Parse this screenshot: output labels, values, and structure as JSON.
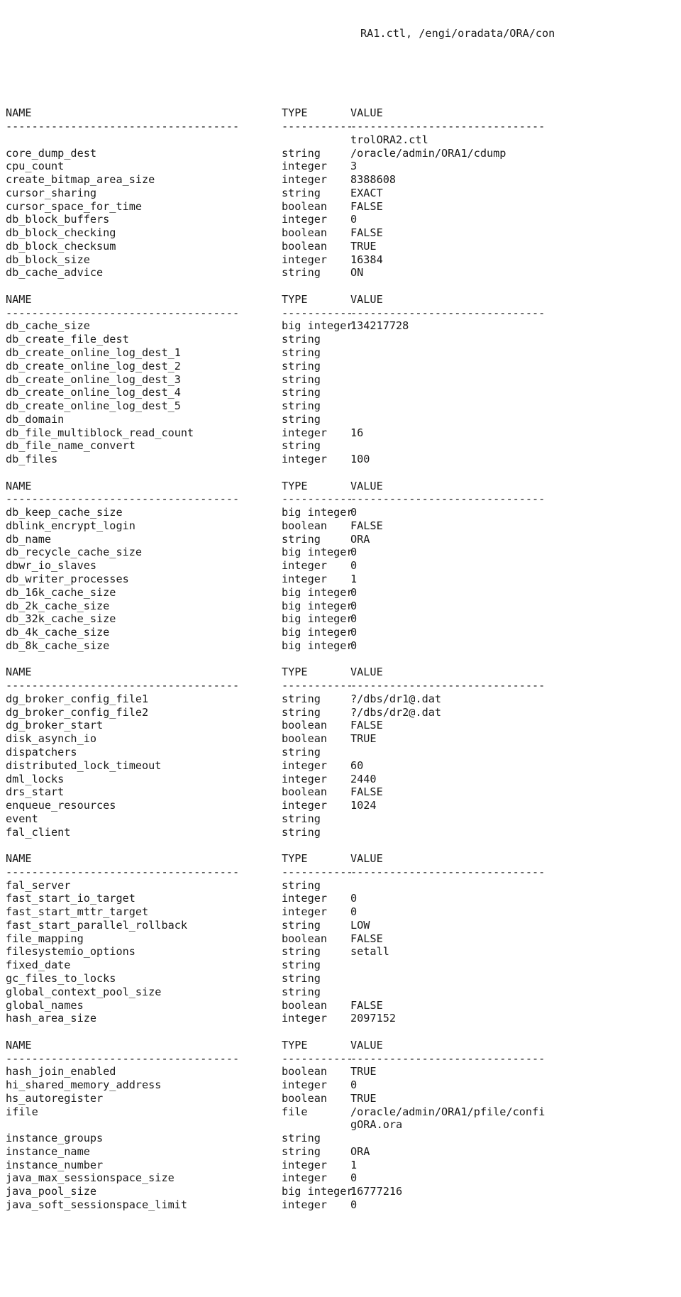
{
  "terminal": {
    "banner": "RA1.ctl, /engi/oradata/ORA/con",
    "columns": {
      "name": "NAME",
      "type": "TYPE",
      "value": "VALUE"
    },
    "rules": {
      "name": "------------------------------------",
      "type": "-----------",
      "value": "------------------------------"
    },
    "blocks": [
      {
        "id": "block-1",
        "wrap_before": "trolORA2.ctl",
        "rows": [
          {
            "name": "core_dump_dest",
            "type": "string",
            "value": "/oracle/admin/ORA1/cdump"
          },
          {
            "name": "cpu_count",
            "type": "integer",
            "value": "3"
          },
          {
            "name": "create_bitmap_area_size",
            "type": "integer",
            "value": "8388608"
          },
          {
            "name": "cursor_sharing",
            "type": "string",
            "value": "EXACT"
          },
          {
            "name": "cursor_space_for_time",
            "type": "boolean",
            "value": "FALSE"
          },
          {
            "name": "db_block_buffers",
            "type": "integer",
            "value": "0"
          },
          {
            "name": "db_block_checking",
            "type": "boolean",
            "value": "FALSE"
          },
          {
            "name": "db_block_checksum",
            "type": "boolean",
            "value": "TRUE"
          },
          {
            "name": "db_block_size",
            "type": "integer",
            "value": "16384"
          },
          {
            "name": "db_cache_advice",
            "type": "string",
            "value": "ON"
          }
        ]
      },
      {
        "id": "block-2",
        "rows": [
          {
            "name": "db_cache_size",
            "type": "big integer",
            "value": "134217728"
          },
          {
            "name": "db_create_file_dest",
            "type": "string",
            "value": ""
          },
          {
            "name": "db_create_online_log_dest_1",
            "type": "string",
            "value": ""
          },
          {
            "name": "db_create_online_log_dest_2",
            "type": "string",
            "value": ""
          },
          {
            "name": "db_create_online_log_dest_3",
            "type": "string",
            "value": ""
          },
          {
            "name": "db_create_online_log_dest_4",
            "type": "string",
            "value": ""
          },
          {
            "name": "db_create_online_log_dest_5",
            "type": "string",
            "value": ""
          },
          {
            "name": "db_domain",
            "type": "string",
            "value": ""
          },
          {
            "name": "db_file_multiblock_read_count",
            "type": "integer",
            "value": "16"
          },
          {
            "name": "db_file_name_convert",
            "type": "string",
            "value": ""
          },
          {
            "name": "db_files",
            "type": "integer",
            "value": "100"
          }
        ]
      },
      {
        "id": "block-3",
        "rows": [
          {
            "name": "db_keep_cache_size",
            "type": "big integer",
            "value": "0"
          },
          {
            "name": "dblink_encrypt_login",
            "type": "boolean",
            "value": "FALSE"
          },
          {
            "name": "db_name",
            "type": "string",
            "value": "ORA"
          },
          {
            "name": "db_recycle_cache_size",
            "type": "big integer",
            "value": "0"
          },
          {
            "name": "dbwr_io_slaves",
            "type": "integer",
            "value": "0"
          },
          {
            "name": "db_writer_processes",
            "type": "integer",
            "value": "1"
          },
          {
            "name": "db_16k_cache_size",
            "type": "big integer",
            "value": "0"
          },
          {
            "name": "db_2k_cache_size",
            "type": "big integer",
            "value": "0"
          },
          {
            "name": "db_32k_cache_size",
            "type": "big integer",
            "value": "0"
          },
          {
            "name": "db_4k_cache_size",
            "type": "big integer",
            "value": "0"
          },
          {
            "name": "db_8k_cache_size",
            "type": "big integer",
            "value": "0"
          }
        ]
      },
      {
        "id": "block-4",
        "rows": [
          {
            "name": "dg_broker_config_file1",
            "type": "string",
            "value": "?/dbs/dr1@.dat"
          },
          {
            "name": "dg_broker_config_file2",
            "type": "string",
            "value": "?/dbs/dr2@.dat"
          },
          {
            "name": "dg_broker_start",
            "type": "boolean",
            "value": "FALSE"
          },
          {
            "name": "disk_asynch_io",
            "type": "boolean",
            "value": "TRUE"
          },
          {
            "name": "dispatchers",
            "type": "string",
            "value": ""
          },
          {
            "name": "distributed_lock_timeout",
            "type": "integer",
            "value": "60"
          },
          {
            "name": "dml_locks",
            "type": "integer",
            "value": "2440"
          },
          {
            "name": "drs_start",
            "type": "boolean",
            "value": "FALSE"
          },
          {
            "name": "enqueue_resources",
            "type": "integer",
            "value": "1024"
          },
          {
            "name": "event",
            "type": "string",
            "value": ""
          },
          {
            "name": "fal_client",
            "type": "string",
            "value": ""
          }
        ]
      },
      {
        "id": "block-5",
        "rows": [
          {
            "name": "fal_server",
            "type": "string",
            "value": ""
          },
          {
            "name": "fast_start_io_target",
            "type": "integer",
            "value": "0"
          },
          {
            "name": "fast_start_mttr_target",
            "type": "integer",
            "value": "0"
          },
          {
            "name": "fast_start_parallel_rollback",
            "type": "string",
            "value": "LOW"
          },
          {
            "name": "file_mapping",
            "type": "boolean",
            "value": "FALSE"
          },
          {
            "name": "filesystemio_options",
            "type": "string",
            "value": "setall"
          },
          {
            "name": "fixed_date",
            "type": "string",
            "value": ""
          },
          {
            "name": "gc_files_to_locks",
            "type": "string",
            "value": ""
          },
          {
            "name": "global_context_pool_size",
            "type": "string",
            "value": ""
          },
          {
            "name": "global_names",
            "type": "boolean",
            "value": "FALSE"
          },
          {
            "name": "hash_area_size",
            "type": "integer",
            "value": "2097152"
          }
        ]
      },
      {
        "id": "block-6",
        "rows": [
          {
            "name": "hash_join_enabled",
            "type": "boolean",
            "value": "TRUE"
          },
          {
            "name": "hi_shared_memory_address",
            "type": "integer",
            "value": "0"
          },
          {
            "name": "hs_autoregister",
            "type": "boolean",
            "value": "TRUE"
          },
          {
            "name": "ifile",
            "type": "file",
            "value": "/oracle/admin/ORA1/pfile/confi",
            "wrap": "gORA.ora"
          },
          {
            "name": "instance_groups",
            "type": "string",
            "value": ""
          },
          {
            "name": "instance_name",
            "type": "string",
            "value": "ORA"
          },
          {
            "name": "instance_number",
            "type": "integer",
            "value": "1"
          },
          {
            "name": "java_max_sessionspace_size",
            "type": "integer",
            "value": "0"
          },
          {
            "name": "java_pool_size",
            "type": "big integer",
            "value": "16777216"
          },
          {
            "name": "java_soft_sessionspace_limit",
            "type": "integer",
            "value": "0"
          }
        ]
      }
    ]
  }
}
